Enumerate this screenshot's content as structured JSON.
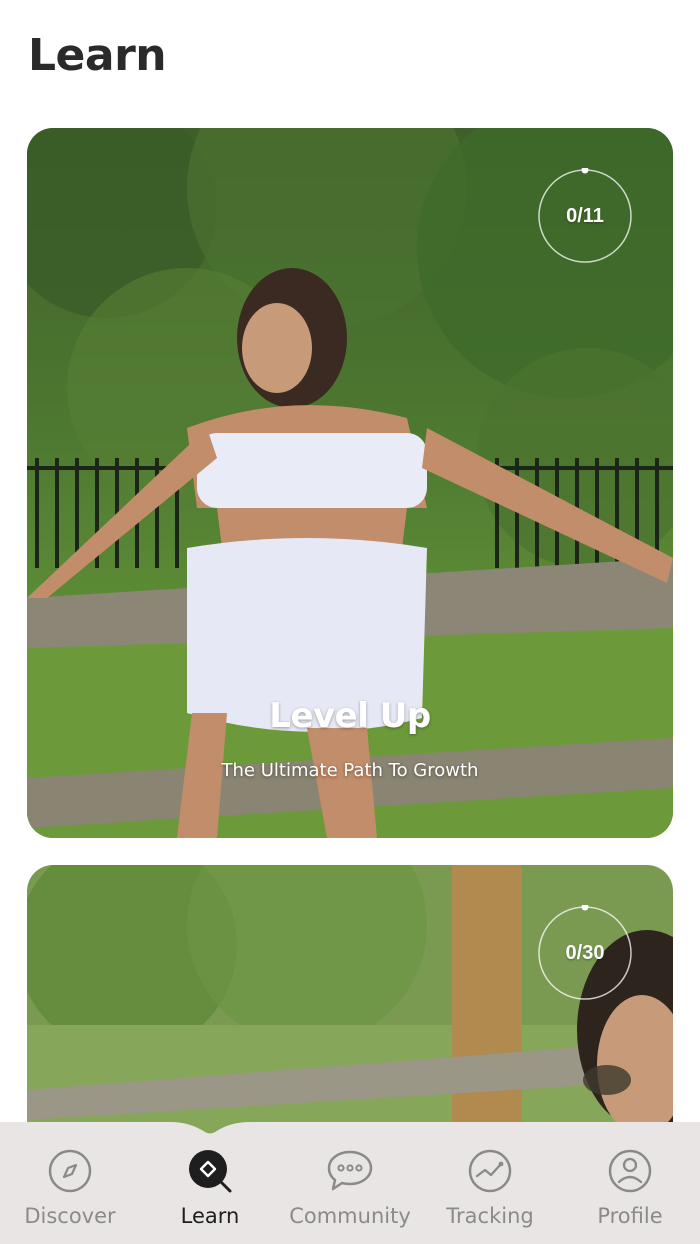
{
  "header": {
    "title": "Learn"
  },
  "cards": [
    {
      "title": "Level Up",
      "subtitle": "The Ultimate Path To Growth",
      "progress": "0/11",
      "image": "woman-in-white-outfit-by-fence"
    },
    {
      "progress": "0/30",
      "image": "woman-with-sunglasses-outdoors"
    }
  ],
  "tabs": [
    {
      "label": "Discover",
      "icon": "compass-icon",
      "active": false
    },
    {
      "label": "Learn",
      "icon": "learn-search-icon",
      "active": true
    },
    {
      "label": "Community",
      "icon": "chat-bubble-icon",
      "active": false
    },
    {
      "label": "Tracking",
      "icon": "tracking-chart-icon",
      "active": false
    },
    {
      "label": "Profile",
      "icon": "profile-icon",
      "active": false
    }
  ],
  "colors": {
    "tab_bar_bg": "#e9e5e5",
    "active": "#1e1e1e",
    "inactive": "#8a8a8a"
  }
}
